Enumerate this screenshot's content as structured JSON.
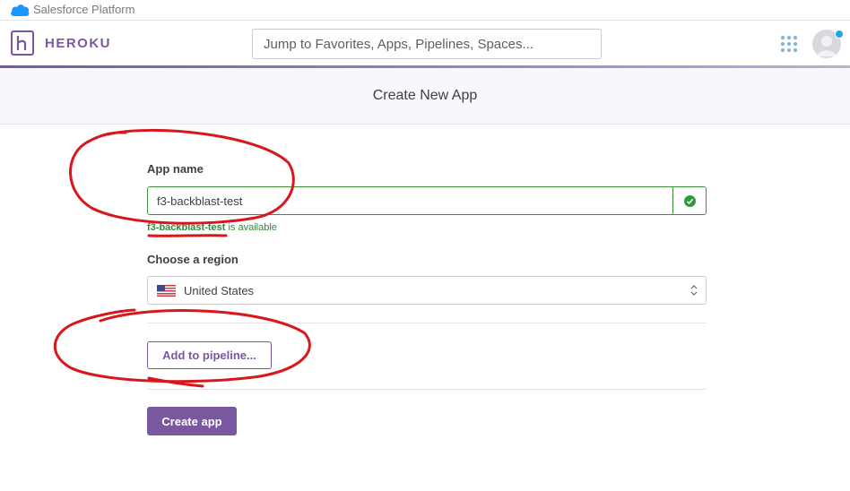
{
  "salesforce_bar": {
    "label": "Salesforce Platform"
  },
  "nav": {
    "brand": "HEROKU",
    "search_placeholder": "Jump to Favorites, Apps, Pipelines, Spaces...",
    "apps_icon": "grid-icon",
    "avatar_icon": "user-avatar-icon"
  },
  "page": {
    "title": "Create New App"
  },
  "form": {
    "app_name_label": "App name",
    "app_name_value": "f3-backblast-test",
    "availability_name": "f3-backblast-test",
    "availability_suffix": " is available",
    "region_label": "Choose a region",
    "region_value": "United States",
    "pipeline_button": "Add to pipeline...",
    "create_button": "Create app"
  },
  "colors": {
    "brand_purple": "#79589f",
    "success_green": "#2f9a3c",
    "annotation_red": "#d9161c"
  }
}
